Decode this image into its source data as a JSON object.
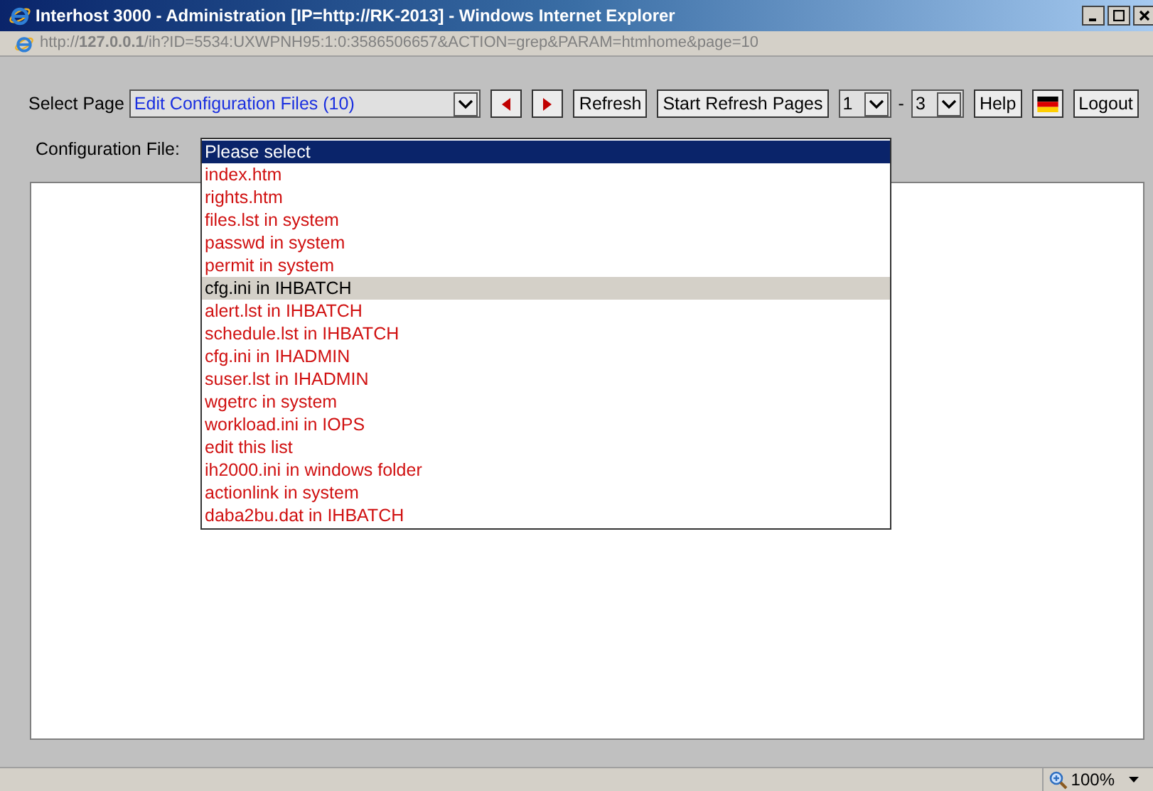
{
  "window": {
    "title": "Interhost 3000 - Administration [IP=http://RK-2013] - Windows Internet Explorer"
  },
  "address_bar": {
    "url": "http://**127.0.0.1**/ih?ID=5534:UXWPNH95:1:0:3586506657&ACTION=grep&PARAM=htmhome&page=10"
  },
  "toolbar": {
    "select_page_label": "Select Page",
    "select_page_value": "Edit Configuration Files (10)",
    "refresh": "Refresh",
    "start_refresh": "Start Refresh Pages",
    "from_value": "1",
    "separator": "-",
    "to_value": "3",
    "help": "Help",
    "logout": "Logout"
  },
  "config": {
    "label": "Configuration File:",
    "options": [
      {
        "label": "Please select",
        "selected": true,
        "hovered": false
      },
      {
        "label": "index.htm",
        "selected": false,
        "hovered": false
      },
      {
        "label": "rights.htm",
        "selected": false,
        "hovered": false
      },
      {
        "label": "files.lst in system",
        "selected": false,
        "hovered": false
      },
      {
        "label": "passwd in system",
        "selected": false,
        "hovered": false
      },
      {
        "label": "permit in system",
        "selected": false,
        "hovered": false
      },
      {
        "label": "cfg.ini in IHBATCH",
        "selected": false,
        "hovered": true
      },
      {
        "label": "alert.lst in IHBATCH",
        "selected": false,
        "hovered": false
      },
      {
        "label": "schedule.lst in IHBATCH",
        "selected": false,
        "hovered": false
      },
      {
        "label": "cfg.ini in IHADMIN",
        "selected": false,
        "hovered": false
      },
      {
        "label": "suser.lst in IHADMIN",
        "selected": false,
        "hovered": false
      },
      {
        "label": "wgetrc in system",
        "selected": false,
        "hovered": false
      },
      {
        "label": "workload.ini in IOPS",
        "selected": false,
        "hovered": false
      },
      {
        "label": "edit this list",
        "selected": false,
        "hovered": false
      },
      {
        "label": "ih2000.ini in windows folder",
        "selected": false,
        "hovered": false
      },
      {
        "label": "actionlink in system",
        "selected": false,
        "hovered": false
      },
      {
        "label": "daba2bu.dat in IHBATCH",
        "selected": false,
        "hovered": false
      }
    ]
  },
  "status_bar": {
    "zoom": "100%"
  }
}
